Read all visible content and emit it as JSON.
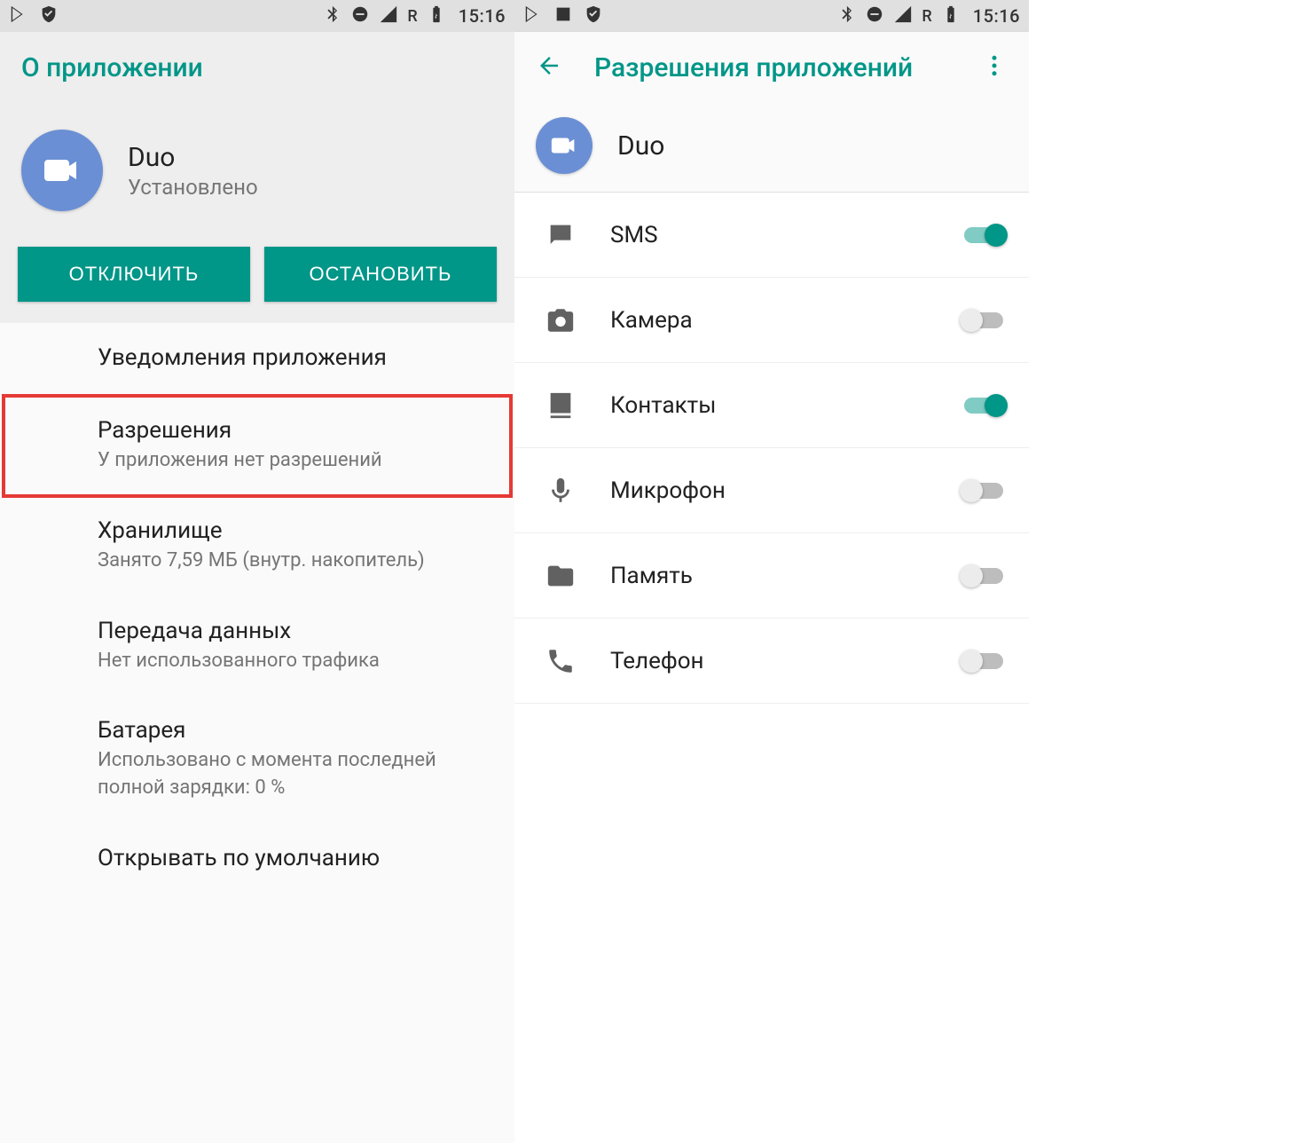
{
  "status": {
    "time": "15:16",
    "roaming": "R"
  },
  "left": {
    "appbar_title": "О приложении",
    "app_name": "Duo",
    "app_status": "Установлено",
    "btn_disable": "ОТКЛЮЧИТЬ",
    "btn_stop": "ОСТАНОВИТЬ",
    "items": [
      {
        "title": "Уведомления приложения",
        "sub": ""
      },
      {
        "title": "Разрешения",
        "sub": "У приложения нет разрешений"
      },
      {
        "title": "Хранилище",
        "sub": "Занято 7,59 МБ (внутр. накопитель)"
      },
      {
        "title": "Передача данных",
        "sub": "Нет использованного трафика"
      },
      {
        "title": "Батарея",
        "sub": "Использовано с момента последней полной зарядки: 0 %"
      },
      {
        "title": "Открывать по умолчанию",
        "sub": ""
      }
    ]
  },
  "right": {
    "appbar_title": "Разрешения приложений",
    "app_name": "Duo",
    "perms": [
      {
        "label": "SMS",
        "on": true
      },
      {
        "label": "Камера",
        "on": false
      },
      {
        "label": "Контакты",
        "on": true
      },
      {
        "label": "Микрофон",
        "on": false
      },
      {
        "label": "Память",
        "on": false
      },
      {
        "label": "Телефон",
        "on": false
      }
    ]
  }
}
